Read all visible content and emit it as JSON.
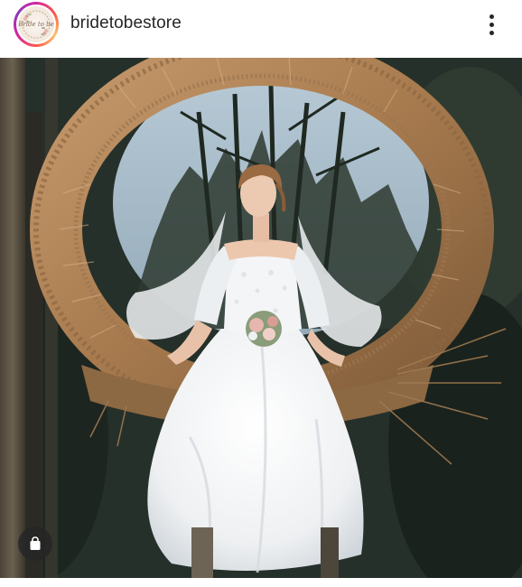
{
  "post": {
    "username": "bridetobestore",
    "avatar_logo_text": "Bride to be",
    "more_icon": "more-vertical-icon",
    "shop_icon": "shopping-bag-icon"
  },
  "colors": {
    "text_primary": "#262626",
    "avatar_ring": [
      "#d6249f",
      "#fd5949",
      "#fdc468"
    ],
    "shop_button_bg": "#262626"
  }
}
